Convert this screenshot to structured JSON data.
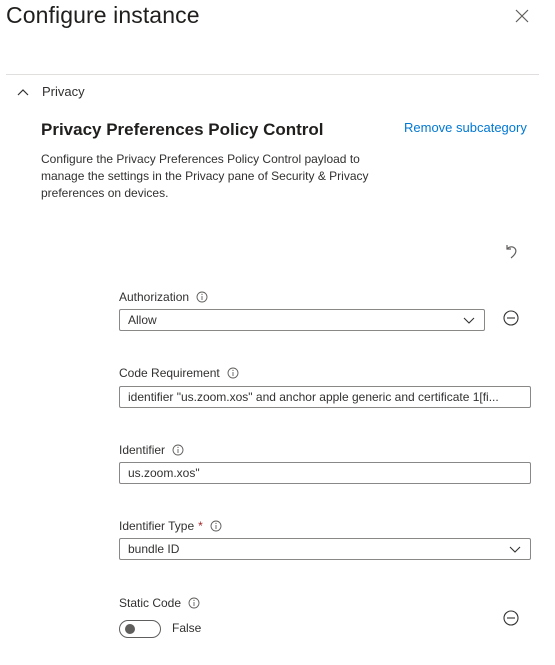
{
  "header": {
    "title": "Configure instance",
    "close_icon": "close-icon"
  },
  "section": {
    "label": "Privacy",
    "expanded": true,
    "icon": "chevron-up-icon"
  },
  "subcategory": {
    "title": "Privacy Preferences Policy Control",
    "remove_label": "Remove subcategory",
    "description": "Configure the Privacy Preferences Policy Control payload to manage the settings in the Privacy pane of Security & Privacy preferences on devices.",
    "undo_icon": "undo-icon"
  },
  "fields": {
    "authorization": {
      "label": "Authorization",
      "value": "Allow",
      "type": "dropdown"
    },
    "code_requirement": {
      "label": "Code Requirement",
      "value": "identifier \"us.zoom.xos\" and anchor apple generic and certificate 1[fi..."
    },
    "identifier": {
      "label": "Identifier",
      "value": "us.zoom.xos\""
    },
    "identifier_type": {
      "label": "Identifier Type",
      "required_marker": "*",
      "value": "bundle ID",
      "type": "dropdown"
    },
    "static_code": {
      "label": "Static Code",
      "toggle_state": "False",
      "checked": false
    }
  },
  "colors": {
    "link": "#0078d4",
    "required": "#a4262c",
    "border": "#8a8886",
    "divider": "#e1dfdd"
  }
}
